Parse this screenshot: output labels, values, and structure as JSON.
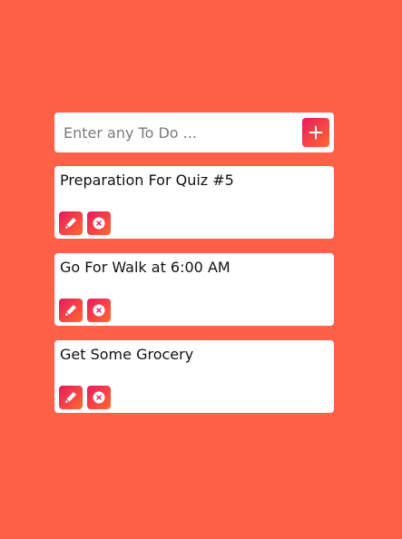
{
  "input": {
    "placeholder": "Enter any To Do ...",
    "value": ""
  },
  "add_button": {
    "icon": "plus-icon"
  },
  "todos": [
    {
      "text": "Preparation For Quiz #5",
      "edit_icon": "pencil-icon",
      "delete_icon": "close-circle-icon"
    },
    {
      "text": "Go For Walk at 6:00 AM",
      "edit_icon": "pencil-icon",
      "delete_icon": "close-circle-icon"
    },
    {
      "text": "Get Some Grocery",
      "edit_icon": "pencil-icon",
      "delete_icon": "close-circle-icon"
    }
  ],
  "colors": {
    "background": "#FF6148",
    "card": "#FFFFFF",
    "gradient_start": "#E8195F",
    "gradient_end": "#FF6A2E"
  }
}
